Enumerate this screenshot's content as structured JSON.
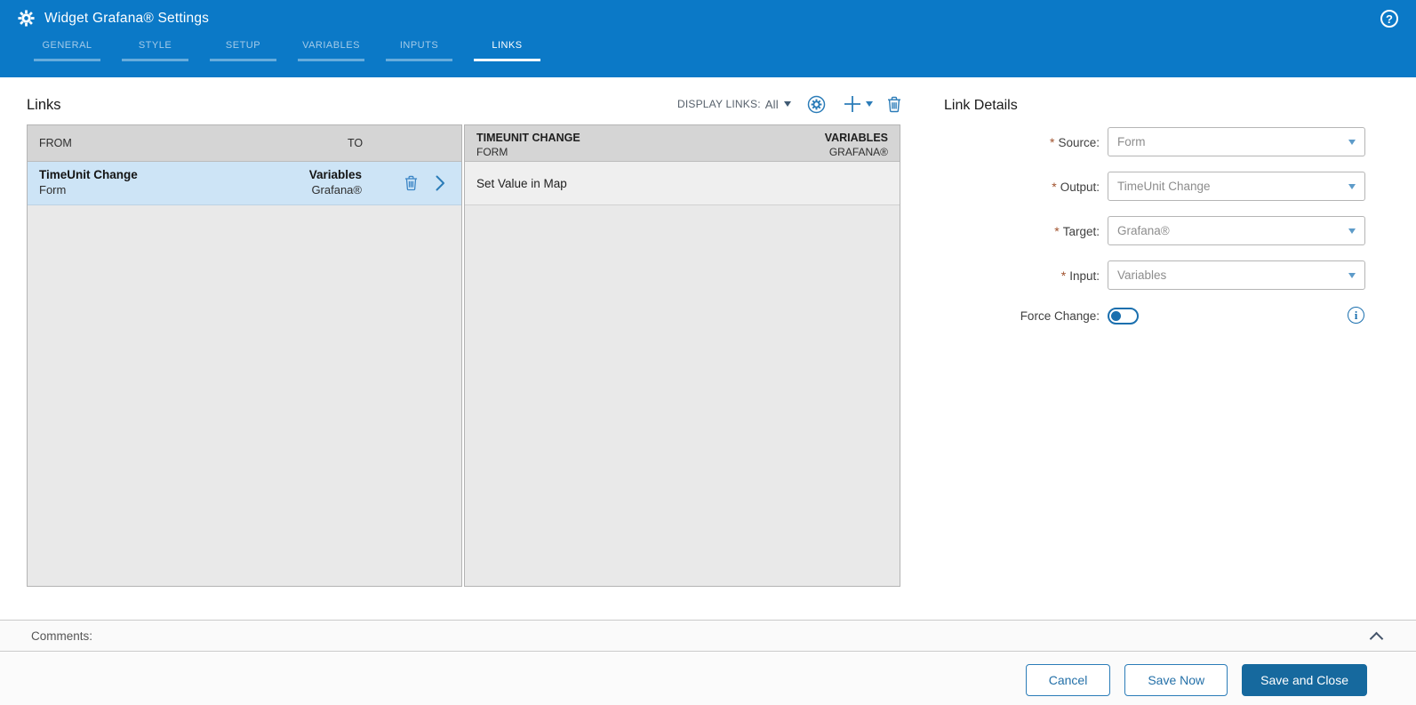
{
  "header": {
    "title": "Widget Grafana® Settings",
    "help_glyph": "?",
    "tabs": [
      {
        "label": "GENERAL",
        "active": false
      },
      {
        "label": "STYLE",
        "active": false
      },
      {
        "label": "SETUP",
        "active": false
      },
      {
        "label": "VARIABLES",
        "active": false
      },
      {
        "label": "INPUTS",
        "active": false
      },
      {
        "label": "LINKS",
        "active": true
      }
    ]
  },
  "links": {
    "title": "Links",
    "toolbar": {
      "display_links_label": "DISPLAY LINKS:",
      "display_links_value": "All"
    },
    "table": {
      "col_from": "FROM",
      "col_to": "TO",
      "row": {
        "from_title": "TimeUnit Change",
        "from_sub": "Form",
        "to_title": "Variables",
        "to_sub": "Grafana®",
        "selected": true
      }
    },
    "detail_table": {
      "header_from_title": "TIMEUNIT CHANGE",
      "header_from_sub": "FORM",
      "header_to_title": "VARIABLES",
      "header_to_sub": "GRAFANA®",
      "action_row": "Set Value in Map"
    }
  },
  "details": {
    "title": "Link Details",
    "required_marker": "*",
    "fields": [
      {
        "label": "Source:",
        "value": "Form",
        "required": true
      },
      {
        "label": "Output:",
        "value": "TimeUnit Change",
        "required": true
      },
      {
        "label": "Target:",
        "value": "Grafana®",
        "required": true
      },
      {
        "label": "Input:",
        "value": "Variables",
        "required": true
      }
    ],
    "force_change_label": "Force Change:",
    "force_change_state": "off",
    "info_glyph": "i"
  },
  "comments": {
    "label": "Comments:"
  },
  "footer": {
    "cancel_label": "Cancel",
    "save_now_label": "Save Now",
    "save_and_close_label": "Save and Close"
  },
  "icons": {
    "gear": "gear-icon",
    "help": "help-icon",
    "sync_gear": "sync-gear-icon",
    "plus": "plus-icon",
    "trash": "trash-icon",
    "chevron_right": "chevron-right-icon",
    "chevron_up": "chevron-up-icon",
    "info": "info-icon"
  },
  "colors": {
    "header_blue": "#0b79c7",
    "accent_blue": "#2b7cb8",
    "selected_row": "#cde4f6",
    "primary_button": "#16699e",
    "required_marker": "#a0522d",
    "table_header_gray": "#d5d5d5",
    "table_body_gray": "#e9e9e9"
  }
}
